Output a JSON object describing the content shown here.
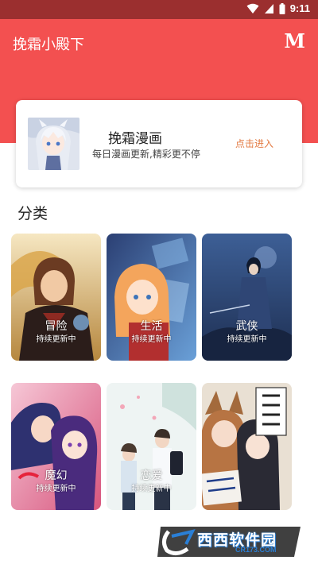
{
  "status_bar": {
    "time": "9:11"
  },
  "header": {
    "title": "挽霜小殿下",
    "logo": "M",
    "color": "#f35050"
  },
  "featured": {
    "title": "挽霜漫画",
    "subtitle": "每日漫画更新,精彩更不停",
    "action": "点击进入",
    "action_color": "#e37a42"
  },
  "section": {
    "title": "分类"
  },
  "categories": [
    {
      "name": "冒险",
      "status": "持续更新中"
    },
    {
      "name": "生活",
      "status": "持续更新中"
    },
    {
      "name": "武侠",
      "status": "持续更新中"
    },
    {
      "name": "魔幻",
      "status": "持续更新中"
    },
    {
      "name": "恋爱",
      "status": "持续更新中"
    },
    {
      "name": "",
      "status": ""
    }
  ],
  "watermark": {
    "brand": "西西软件园",
    "url": "CR173.COM"
  }
}
